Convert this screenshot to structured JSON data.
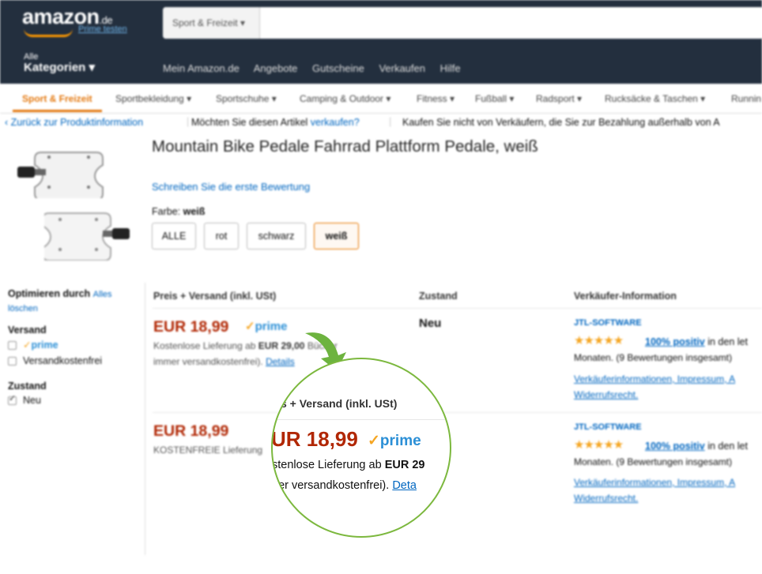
{
  "header": {
    "logo_text": "amazon",
    "logo_tld": ".de",
    "prime_link": "Prime testen",
    "search_category": "Sport & Freizeit",
    "all_small": "Alle",
    "all_big": "Kategorien",
    "nav_links": [
      "Mein Amazon.de",
      "Angebote",
      "Gutscheine",
      "Verkaufen",
      "Hilfe"
    ]
  },
  "subnav": {
    "items": [
      "Sport & Freizeit",
      "Sportbekleidung",
      "Sportschuhe",
      "Camping & Outdoor",
      "Fitness",
      "Fußball",
      "Radsport",
      "Rucksäcke & Taschen",
      "Runnin"
    ]
  },
  "infobar": {
    "back": "‹ Zurück zur Produktinformation",
    "sell_q": "Möchten Sie diesen Artikel",
    "sell_link": "verkaufen?",
    "warning": "Kaufen Sie nicht von Verkäufern, die Sie zur Bezahlung außerhalb von A"
  },
  "product": {
    "title": "Mountain Bike Pedale Fahrrad Plattform Pedale, weiß",
    "review_link": "Schreiben Sie die erste Bewertung",
    "farbe_label": "Farbe:",
    "farbe_value": "weiß",
    "chips": [
      "ALLE",
      "rot",
      "schwarz",
      "weiß"
    ]
  },
  "sidebar": {
    "optimize": "Optimieren durch",
    "clear_all": "Alles",
    "clear_all_2": "löschen",
    "versand": "Versand",
    "prime": "prime",
    "free_shipping": "Versandkostenfrei",
    "zustand": "Zustand",
    "neu": "Neu"
  },
  "table": {
    "col_price": "Preis + Versand (inkl. USt)",
    "col_condition": "Zustand",
    "col_seller": "Verkäufer-Information",
    "rows": [
      {
        "price": "EUR 18,99",
        "prime": "prime",
        "ship_line1_pre": "Kostenlose Lieferung ab",
        "ship_line1_bold": "EUR 29,00",
        "ship_line1_post": "Bücher",
        "ship_line2": "immer versandkostenfrei).",
        "ship_link": "Details",
        "condition": "Neu",
        "seller": "JTL-SOFTWARE",
        "stars": "★★★★★",
        "positive": "100% positiv",
        "positive_post": "in den let",
        "months": "Monaten. (9 Bewertungen insgesamt)",
        "info1": "Verkäuferinformationen, Impressum, A",
        "info2": "Widerrufsrecht."
      },
      {
        "price": "EUR 18,99",
        "ship_line1": "KOSTENFREIE Lieferung",
        "seller": "JTL-SOFTWARE",
        "stars": "★★★★★",
        "positive": "100% positiv",
        "positive_post": "in den let",
        "months": "Monaten. (9 Bewertungen insgesamt)",
        "info1": "Verkäuferinformationen, Impressum, A",
        "info2": "Widerrufsrecht."
      }
    ]
  },
  "zoom": {
    "header": "s + Versand (inkl. USt)",
    "price": "UR 18,99",
    "prime": "prime",
    "ship1_pre": "stenlose Lieferung ab",
    "ship1_bold": "EUR 29",
    "ship2_pre": "ner versandkostenfrei).",
    "ship2_link": "Deta"
  },
  "colors": {
    "header_bg": "#232f3e",
    "price": "#b12704",
    "link": "#0066c0",
    "accent": "#e47911",
    "zoom_ring": "#7cb83e"
  }
}
